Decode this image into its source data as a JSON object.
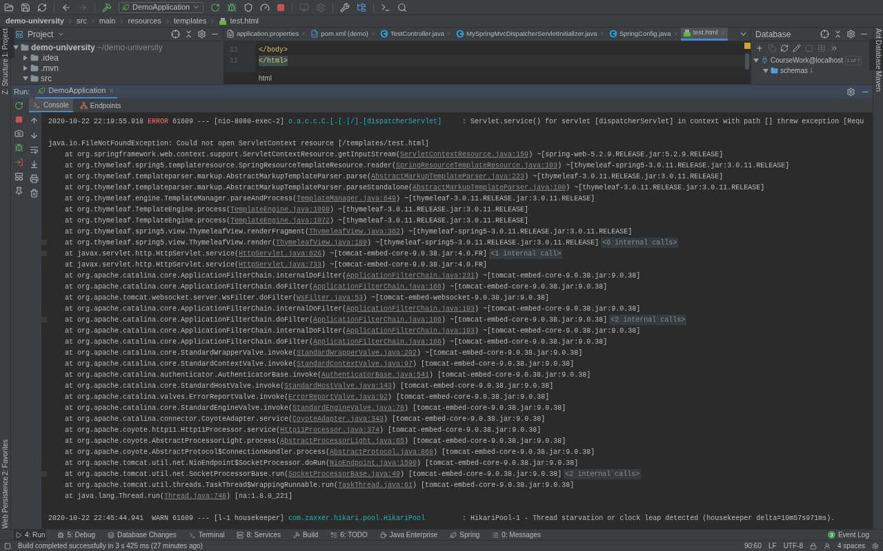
{
  "toolbar": {
    "run_config": "DemoApplication"
  },
  "breadcrumbs": [
    "demo-university",
    "src",
    "main",
    "resources",
    "templates",
    "test.html"
  ],
  "left_stripe": {
    "top": [
      {
        "label": "1: Project",
        "selected": true
      },
      {
        "label": "Z: Structure",
        "selected": false
      }
    ],
    "bottom": [
      {
        "label": "2: Favorites",
        "selected": false
      },
      {
        "label": "Persistence",
        "selected": false
      },
      {
        "label": "Web",
        "selected": false
      }
    ]
  },
  "right_stripe": [
    {
      "label": "Ant",
      "selected": false
    },
    {
      "label": "Database",
      "selected": true
    },
    {
      "label": "Maven",
      "selected": false
    }
  ],
  "project": {
    "title": "Project",
    "tree": [
      {
        "name": "demo-university",
        "path": "~/demo-university",
        "expanded": true,
        "children": [
          {
            "name": ".idea",
            "expanded": false
          },
          {
            "name": ".mvn",
            "expanded": false
          },
          {
            "name": "src",
            "expanded": true
          }
        ]
      }
    ]
  },
  "editor": {
    "tabs": [
      {
        "label": "application.properties",
        "kind": "properties",
        "selected": false
      },
      {
        "label": "pom.xml (demo)",
        "kind": "maven",
        "selected": false
      },
      {
        "label": "TestController.java",
        "kind": "class",
        "selected": false
      },
      {
        "label": "MySpringMvcDispatcherServletInitializer.java",
        "kind": "class",
        "selected": false
      },
      {
        "label": "SpringConfig.java",
        "kind": "class",
        "selected": false
      },
      {
        "label": "test.html",
        "kind": "html",
        "selected": true
      }
    ],
    "lines": [
      {
        "number": "11",
        "code": "</body>",
        "current": false
      },
      {
        "number": "12",
        "code": "</html>",
        "current": true
      }
    ],
    "breadcrumb": "html"
  },
  "database": {
    "title": "Database",
    "tree": [
      {
        "name": "CourseWork@localhost",
        "badge": "1 of 7",
        "expanded": true,
        "children": [
          {
            "name": "schemas",
            "count": "1",
            "expanded": true
          }
        ]
      }
    ]
  },
  "run": {
    "title": "Run:",
    "tab": "DemoApplication",
    "tabs": [
      {
        "label": "Console",
        "selected": true
      },
      {
        "label": "Endpoints",
        "selected": false
      }
    ],
    "console": [
      {
        "kind": "log",
        "timestamp": "2020-10-22 22:19:55.918",
        "level": "ERROR",
        "pid": "61609",
        "separator": "---",
        "thread": "[nio-8080-exec-2]",
        "logger": "o.a.c.c.C.[.[.[/].[dispatcherServlet]",
        "message": ": Servlet.service() for servlet [dispatcherServlet] in context with path [] threw exception [Requ"
      },
      {
        "kind": "blank"
      },
      {
        "kind": "exception",
        "text": "java.io.FileNotFoundException: Could not open ServletContext resource [/templates/test.html]"
      },
      {
        "kind": "frame",
        "head": "at org.springframework.web.context.support.ServletContextResource.getInputStream(",
        "link": "ServletContextResource.java:159",
        "tail": ") ~[spring-web-5.2.9.RELEASE.jar:5.2.9.RELEASE]",
        "foldable": false
      },
      {
        "kind": "frame",
        "head": "at org.thymeleaf.spring5.templateresource.SpringResourceTemplateResource.reader(",
        "link": "SpringResourceTemplateResource.java:103",
        "tail": ") ~[thymeleaf-spring5-3.0.11.RELEASE.jar:3.0.11.RELEASE]",
        "foldable": false
      },
      {
        "kind": "frame",
        "head": "at org.thymeleaf.templateparser.markup.AbstractMarkupTemplateParser.parse(",
        "link": "AbstractMarkupTemplateParser.java:223",
        "tail": ") ~[thymeleaf-3.0.11.RELEASE.jar:3.0.11.RELEASE]",
        "foldable": false
      },
      {
        "kind": "frame",
        "head": "at org.thymeleaf.templateparser.markup.AbstractMarkupTemplateParser.parseStandalone(",
        "link": "AbstractMarkupTemplateParser.java:100",
        "tail": ") ~[thymeleaf-3.0.11.RELEASE.jar:3.0.11.RELEASE]",
        "foldable": false
      },
      {
        "kind": "frame",
        "head": "at org.thymeleaf.engine.TemplateManager.parseAndProcess(",
        "link": "TemplateManager.java:649",
        "tail": ") ~[thymeleaf-3.0.11.RELEASE.jar:3.0.11.RELEASE]",
        "foldable": false
      },
      {
        "kind": "frame",
        "head": "at org.thymeleaf.TemplateEngine.process(",
        "link": "TemplateEngine.java:1098",
        "tail": ") ~[thymeleaf-3.0.11.RELEASE.jar:3.0.11.RELEASE]",
        "foldable": false
      },
      {
        "kind": "frame",
        "head": "at org.thymeleaf.TemplateEngine.process(",
        "link": "TemplateEngine.java:1072",
        "tail": ") ~[thymeleaf-3.0.11.RELEASE.jar:3.0.11.RELEASE]",
        "foldable": false
      },
      {
        "kind": "frame",
        "head": "at org.thymeleaf.spring5.view.ThymeleafView.renderFragment(",
        "link": "ThymeleafView.java:362",
        "tail": ") ~[thymeleaf-spring5-3.0.11.RELEASE.jar:3.0.11.RELEASE]",
        "foldable": false
      },
      {
        "kind": "frame",
        "head": "at org.thymeleaf.spring5.view.ThymeleafView.render(",
        "link": "ThymeleafView.java:189",
        "tail": ") ~[thymeleaf-spring5-3.0.11.RELEASE.jar:3.0.11.RELEASE]",
        "internal": "<6 internal calls>",
        "foldable": true
      },
      {
        "kind": "frame",
        "head": "at javax.servlet.http.HttpServlet.service(",
        "link": "HttpServlet.java:626",
        "tail": ") ~[tomcat-embed-core-9.0.38.jar:4.0.FR]",
        "internal": "<1 internal call>",
        "foldable": true
      },
      {
        "kind": "frame",
        "head": "at javax.servlet.http.HttpServlet.service(",
        "link": "HttpServlet.java:733",
        "tail": ") ~[tomcat-embed-core-9.0.38.jar:4.0.FR]",
        "foldable": false
      },
      {
        "kind": "frame",
        "head": "at org.apache.catalina.core.ApplicationFilterChain.internalDoFilter(",
        "link": "ApplicationFilterChain.java:231",
        "tail": ") ~[tomcat-embed-core-9.0.38.jar:9.0.38]",
        "foldable": false
      },
      {
        "kind": "frame",
        "head": "at org.apache.catalina.core.ApplicationFilterChain.doFilter(",
        "link": "ApplicationFilterChain.java:166",
        "tail": ") ~[tomcat-embed-core-9.0.38.jar:9.0.38]",
        "foldable": false
      },
      {
        "kind": "frame",
        "head": "at org.apache.tomcat.websocket.server.WsFilter.doFilter(",
        "link": "WsFilter.java:53",
        "tail": ") ~[tomcat-embed-websocket-9.0.38.jar:9.0.38]",
        "foldable": false
      },
      {
        "kind": "frame",
        "head": "at org.apache.catalina.core.ApplicationFilterChain.internalDoFilter(",
        "link": "ApplicationFilterChain.java:193",
        "tail": ") ~[tomcat-embed-core-9.0.38.jar:9.0.38]",
        "foldable": false
      },
      {
        "kind": "frame",
        "head": "at org.apache.catalina.core.ApplicationFilterChain.doFilter(",
        "link": "ApplicationFilterChain.java:166",
        "tail": ") ~[tomcat-embed-core-9.0.38.jar:9.0.38]",
        "internal": "<2 internal calls>",
        "foldable": true
      },
      {
        "kind": "frame",
        "head": "at org.apache.catalina.core.ApplicationFilterChain.internalDoFilter(",
        "link": "ApplicationFilterChain.java:193",
        "tail": ") ~[tomcat-embed-core-9.0.38.jar:9.0.38]",
        "foldable": false
      },
      {
        "kind": "frame",
        "head": "at org.apache.catalina.core.ApplicationFilterChain.doFilter(",
        "link": "ApplicationFilterChain.java:166",
        "tail": ") ~[tomcat-embed-core-9.0.38.jar:9.0.38]",
        "foldable": false
      },
      {
        "kind": "frame",
        "head": "at org.apache.catalina.core.StandardWrapperValve.invoke(",
        "link": "StandardWrapperValve.java:202",
        "tail": ") ~[tomcat-embed-core-9.0.38.jar:9.0.38]",
        "foldable": false
      },
      {
        "kind": "frame",
        "head": "at org.apache.catalina.core.StandardContextValve.invoke(",
        "link": "StandardContextValve.java:97",
        "tail": ") [tomcat-embed-core-9.0.38.jar:9.0.38]",
        "foldable": false
      },
      {
        "kind": "frame",
        "head": "at org.apache.catalina.authenticator.AuthenticatorBase.invoke(",
        "link": "AuthenticatorBase.java:541",
        "tail": ") [tomcat-embed-core-9.0.38.jar:9.0.38]",
        "foldable": false
      },
      {
        "kind": "frame",
        "head": "at org.apache.catalina.core.StandardHostValve.invoke(",
        "link": "StandardHostValve.java:143",
        "tail": ") [tomcat-embed-core-9.0.38.jar:9.0.38]",
        "foldable": false
      },
      {
        "kind": "frame",
        "head": "at org.apache.catalina.valves.ErrorReportValve.invoke(",
        "link": "ErrorReportValve.java:92",
        "tail": ") [tomcat-embed-core-9.0.38.jar:9.0.38]",
        "foldable": false
      },
      {
        "kind": "frame",
        "head": "at org.apache.catalina.core.StandardEngineValve.invoke(",
        "link": "StandardEngineValve.java:78",
        "tail": ") [tomcat-embed-core-9.0.38.jar:9.0.38]",
        "foldable": false
      },
      {
        "kind": "frame",
        "head": "at org.apache.catalina.connector.CoyoteAdapter.service(",
        "link": "CoyoteAdapter.java:343",
        "tail": ") [tomcat-embed-core-9.0.38.jar:9.0.38]",
        "foldable": false
      },
      {
        "kind": "frame",
        "head": "at org.apache.coyote.http11.Http11Processor.service(",
        "link": "Http11Processor.java:374",
        "tail": ") [tomcat-embed-core-9.0.38.jar:9.0.38]",
        "foldable": false
      },
      {
        "kind": "frame",
        "head": "at org.apache.coyote.AbstractProcessorLight.process(",
        "link": "AbstractProcessorLight.java:65",
        "tail": ") [tomcat-embed-core-9.0.38.jar:9.0.38]",
        "foldable": false
      },
      {
        "kind": "frame",
        "head": "at org.apache.coyote.AbstractProtocol$ConnectionHandler.process(",
        "link": "AbstractProtocol.java:868",
        "tail": ") [tomcat-embed-core-9.0.38.jar:9.0.38]",
        "foldable": false
      },
      {
        "kind": "frame",
        "head": "at org.apache.tomcat.util.net.NioEndpoint$SocketProcessor.doRun(",
        "link": "NioEndpoint.java:1590",
        "tail": ") [tomcat-embed-core-9.0.38.jar:9.0.38]",
        "foldable": false
      },
      {
        "kind": "frame",
        "head": "at org.apache.tomcat.util.net.SocketProcessorBase.run(",
        "link": "SocketProcessorBase.java:49",
        "tail": ") [tomcat-embed-core-9.0.38.jar:9.0.38]",
        "internal": "<2 internal calls>",
        "foldable": true
      },
      {
        "kind": "frame",
        "head": "at org.apache.tomcat.util.threads.TaskThread$WrappingRunnable.run(",
        "link": "TaskThread.java:61",
        "tail": ") [tomcat-embed-core-9.0.38.jar:9.0.38]",
        "foldable": false
      },
      {
        "kind": "frame",
        "head": "at java.lang.Thread.run(",
        "link": "Thread.java:748",
        "tail": ") [na:1.8.0_221]",
        "foldable": false
      },
      {
        "kind": "blank"
      },
      {
        "kind": "log",
        "timestamp": "2020-10-22 22:45:44.941",
        "level": "WARN",
        "pid": "61609",
        "separator": "---",
        "thread": "[l-1 housekeeper]",
        "logger": "com.zaxxer.hikari.pool.HikariPool",
        "message": ": HikariPool-1 - Thread starvation or clock leap detected (housekeeper delta=10m57s971ms)."
      }
    ]
  },
  "tool_tabs": [
    {
      "label": "4: Run",
      "kind": "run",
      "selected": true
    },
    {
      "label": "5: Debug",
      "kind": "debug",
      "selected": false
    },
    {
      "label": "Database Changes",
      "kind": "changes",
      "selected": false
    },
    {
      "label": "Terminal",
      "kind": "terminal",
      "selected": false
    },
    {
      "label": "8: Services",
      "kind": "services",
      "selected": false
    },
    {
      "label": "Build",
      "kind": "build",
      "selected": false
    },
    {
      "label": "6: TODO",
      "kind": "todo",
      "selected": false
    },
    {
      "label": "Java Enterprise",
      "kind": "enterprise",
      "selected": false
    },
    {
      "label": "Spring",
      "kind": "spring",
      "selected": false
    },
    {
      "label": "0: Messages",
      "kind": "messages",
      "selected": false
    }
  ],
  "event_log": {
    "label": "Event Log",
    "count": "3"
  },
  "status_bar": {
    "message": "Build completed successfully in 3 s 425 ms (27 minutes ago)",
    "position": "90:60",
    "line_ending": "LF",
    "encoding": "UTF-8",
    "indent": "4 spaces"
  }
}
